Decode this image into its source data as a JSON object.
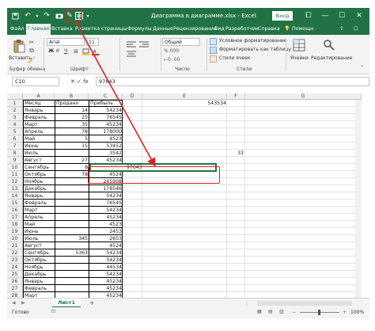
{
  "title": {
    "file": "Диаграмма в диаграмме.xlsx",
    "separator": "-",
    "app": "Excel",
    "login": "Вход"
  },
  "window_buttons": {
    "help": "⧠",
    "minimize": "—",
    "maximize": "☐",
    "close": "✕"
  },
  "tabs": [
    "Файл",
    "Главная",
    "Вставка",
    "Разметка страницы",
    "Формулы",
    "Данные",
    "Рецензирование",
    "Вид",
    "Разработчик",
    "Справка"
  ],
  "tabs_right": {
    "tell": "Помощн"
  },
  "ribbon": {
    "paste_label": "Вставить",
    "clipboard_group": "Буфер обмена",
    "font_name": "Arial",
    "font_size": "11",
    "font_group": "Шрифт",
    "number_format": "Общий",
    "number_group": "Число",
    "cond_format": "Условное форматирование",
    "table_format": "Форматировать как таблицу",
    "cell_styles": "Стили ячеек",
    "styles_group": "Стили",
    "cells_label": "Ячейки",
    "editing_label": "Редактирование",
    "bold": "Ж",
    "italic": "К",
    "underline": "Ч"
  },
  "formula_bar": {
    "name_box": "C10",
    "icons": "✕ ✓ fx",
    "value": "97643"
  },
  "columns": [
    "A",
    "B",
    "C",
    "D",
    "E",
    "F",
    "G"
  ],
  "rows": [
    "1",
    "2",
    "3",
    "4",
    "5",
    "6",
    "7",
    "8",
    "9",
    "10",
    "11",
    "12",
    "13",
    "14",
    "15",
    "16",
    "17",
    "18",
    "19",
    "20",
    "21",
    "22",
    "23",
    "24",
    "25",
    "26",
    "27",
    "28"
  ],
  "table": {
    "headers": [
      "Месяц",
      "Продано",
      "Прибыль"
    ],
    "months": [
      "Январь",
      "Февраль",
      "Март",
      "Апрель",
      "Май",
      "Июнь",
      "Июль",
      "Август",
      "Сентябрь",
      "Октябрь",
      "Ноябрь",
      "Декабрь",
      "Январь",
      "Февраль",
      "Март",
      "Апрель",
      "Май",
      "Июнь",
      "Июль",
      "Август",
      "Сентябрь",
      "Октябрь",
      "Ноябрь",
      "Декабрь",
      "Январь",
      "Февраль",
      "Март"
    ],
    "sold": [
      "14",
      "25",
      "35",
      "78",
      "5",
      "15",
      "",
      "27",
      "8",
      "78",
      "",
      "",
      "",
      "",
      "",
      "",
      "",
      "",
      "345",
      "",
      "5363",
      "",
      "",
      "",
      "",
      "",
      ""
    ],
    "profit": [
      "54234",
      "76545",
      "45234",
      "178000",
      "4523",
      "53452",
      "3542",
      "45234",
      "",
      "4524",
      "245908",
      "178546",
      "54234",
      "76545",
      "54234",
      "45234",
      "4523",
      "2453",
      "2653",
      "4524",
      "54234",
      "54234",
      "44534",
      "54234",
      "45234",
      "45234",
      "45234"
    ]
  },
  "cells_extra": {
    "e1": "543534",
    "g8": "33",
    "d10_value": "97643"
  },
  "sheet": {
    "tab": "Лист1",
    "add": "+"
  },
  "status": {
    "ready": "Готово",
    "zoom": "100%"
  }
}
